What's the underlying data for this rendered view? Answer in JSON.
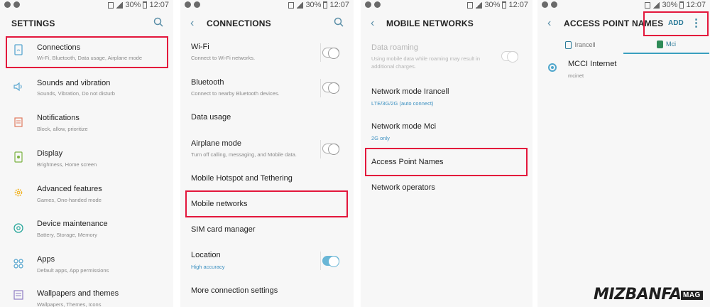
{
  "status": {
    "battery": "30%",
    "time": "12:07"
  },
  "settings": {
    "title": "SETTINGS",
    "items": [
      {
        "title": "Connections",
        "sub": "Wi-Fi, Bluetooth, Data usage, Airplane mode",
        "icon": "connections-icon"
      },
      {
        "title": "Sounds and vibration",
        "sub": "Sounds, Vibration, Do not disturb",
        "icon": "speaker-icon"
      },
      {
        "title": "Notifications",
        "sub": "Block, allow, prioritize",
        "icon": "notifications-icon"
      },
      {
        "title": "Display",
        "sub": "Brightness, Home screen",
        "icon": "display-icon"
      },
      {
        "title": "Advanced features",
        "sub": "Games, One-handed mode",
        "icon": "gear-icon"
      },
      {
        "title": "Device maintenance",
        "sub": "Battery, Storage, Memory",
        "icon": "maintenance-icon"
      },
      {
        "title": "Apps",
        "sub": "Default apps, App permissions",
        "icon": "apps-icon"
      },
      {
        "title": "Wallpapers and themes",
        "sub": "Wallpapers, Themes, Icons",
        "icon": "wallpaper-icon"
      }
    ]
  },
  "connections": {
    "title": "CONNECTIONS",
    "items": [
      {
        "title": "Wi-Fi",
        "sub": "Connect to Wi-Fi networks."
      },
      {
        "title": "Bluetooth",
        "sub": "Connect to nearby Bluetooth devices."
      },
      {
        "title": "Data usage",
        "sub": ""
      },
      {
        "title": "Airplane mode",
        "sub": "Turn off calling, messaging, and Mobile data."
      },
      {
        "title": "Mobile Hotspot and Tethering",
        "sub": ""
      },
      {
        "title": "Mobile networks",
        "sub": ""
      },
      {
        "title": "SIM card manager",
        "sub": ""
      },
      {
        "title": "Location",
        "sub": "High accuracy"
      },
      {
        "title": "More connection settings",
        "sub": ""
      }
    ]
  },
  "mobile_networks": {
    "title": "MOBILE NETWORKS",
    "data_roaming": {
      "title": "Data roaming",
      "sub1": "Using mobile data while roaming may result in",
      "sub2": "additional charges."
    },
    "items": [
      {
        "title": "Network mode Irancell",
        "sub": "LTE/3G/2G (auto connect)"
      },
      {
        "title": "Network mode Mci",
        "sub": "2G only"
      },
      {
        "title": "Access Point Names",
        "sub": ""
      },
      {
        "title": "Network operators",
        "sub": ""
      }
    ]
  },
  "apn": {
    "title": "ACCESS POINT NAMES",
    "add_label": "ADD",
    "more_label": "⋮",
    "tabs": [
      "Irancell",
      "Mci"
    ],
    "entry": {
      "name": "MCCI Internet",
      "apn": "mcinet"
    }
  },
  "brand": {
    "name": "MIZBANFA",
    "tag": "MAG"
  },
  "colors": {
    "accent": "#3a9fbf",
    "highlight": "#e3173c"
  }
}
